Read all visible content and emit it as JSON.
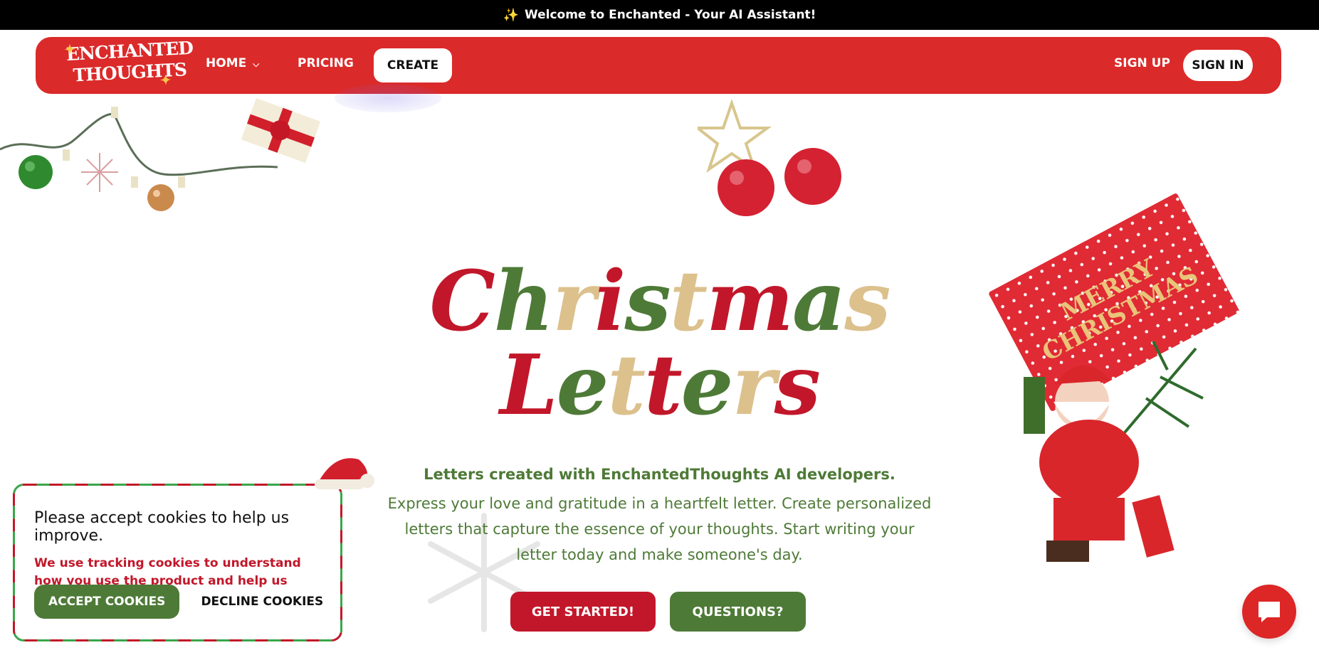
{
  "announcement": {
    "icon": "sparkles-icon",
    "text": "Welcome to Enchanted - Your AI Assistant!"
  },
  "nav": {
    "logo_line1": "ENCHANTED",
    "logo_line2": "THOUGHTS",
    "home": "HOME",
    "pricing": "PRICING",
    "create": "CREATE",
    "sign_up": "SIGN UP",
    "sign_in": "SIGN IN"
  },
  "hero": {
    "title_line1": [
      "C",
      "h",
      "r",
      "i",
      "s",
      "t",
      "m",
      "a",
      "s"
    ],
    "title_line2": [
      "L",
      "e",
      "t",
      "t",
      "e",
      "r",
      "s"
    ],
    "subheading": "Letters created with EnchantedThoughts AI developers.",
    "description": "Express your love and gratitude in a heartfelt letter. Create personalized letters that capture the essence of your thoughts. Start writing your letter today and make someone's day.",
    "get_started": "GET STARTED!",
    "questions": "QUESTIONS?",
    "card_text_line1": "MERRY",
    "card_text_line2": "CHRISTMAS"
  },
  "cookie": {
    "title": "Please accept cookies to help us improve.",
    "text": "We use tracking cookies to understand how you use the product and help us improve it.",
    "accept": "ACCEPT COOKIES",
    "decline": "DECLINE COOKIES"
  },
  "colors": {
    "brand_red": "#db2a2a",
    "title_red": "#c2172a",
    "green": "#4e7a37",
    "beige": "#dcc18d"
  }
}
